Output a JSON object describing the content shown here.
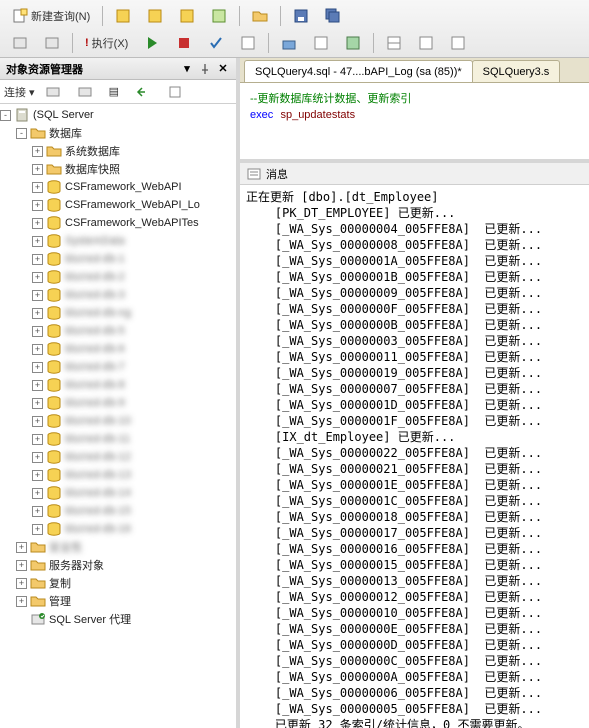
{
  "toolbar": {
    "newQuery": "新建查询(N)",
    "execute": "执行(X)"
  },
  "sidebar": {
    "title": "对象资源管理器",
    "connectLabel": "连接 ▾",
    "nodes": [
      {
        "depth": 0,
        "toggle": "-",
        "icon": "server",
        "label": "",
        "suffix": "(SQL Server",
        "blur": true
      },
      {
        "depth": 1,
        "toggle": "-",
        "icon": "folder",
        "label": "数据库"
      },
      {
        "depth": 2,
        "toggle": "+",
        "icon": "folder",
        "label": "系统数据库"
      },
      {
        "depth": 2,
        "toggle": "+",
        "icon": "folder",
        "label": "数据库快照"
      },
      {
        "depth": 2,
        "toggle": "+",
        "icon": "db",
        "label": "CSFramework_WebAPI"
      },
      {
        "depth": 2,
        "toggle": "+",
        "icon": "db",
        "label": "CSFramework_WebAPI_Lo"
      },
      {
        "depth": 2,
        "toggle": "+",
        "icon": "db",
        "label": "CSFramework_WebAPITes"
      },
      {
        "depth": 2,
        "toggle": "+",
        "icon": "db",
        "label": "SystemData",
        "blur": true
      },
      {
        "depth": 2,
        "toggle": "+",
        "icon": "db",
        "label": "blurred-db-1",
        "blur": true
      },
      {
        "depth": 2,
        "toggle": "+",
        "icon": "db",
        "label": "blurred-db-2",
        "blur": true
      },
      {
        "depth": 2,
        "toggle": "+",
        "icon": "db",
        "label": "blurred-db-3",
        "blur": true
      },
      {
        "depth": 2,
        "toggle": "+",
        "icon": "db",
        "label": "blurred-db-ng",
        "blur": true
      },
      {
        "depth": 2,
        "toggle": "+",
        "icon": "db",
        "label": "blurred-db-5",
        "blur": true
      },
      {
        "depth": 2,
        "toggle": "+",
        "icon": "db",
        "label": "blurred-db-6",
        "blur": true
      },
      {
        "depth": 2,
        "toggle": "+",
        "icon": "db",
        "label": "blurred-db-7",
        "blur": true
      },
      {
        "depth": 2,
        "toggle": "+",
        "icon": "db",
        "label": "blurred-db-8",
        "blur": true
      },
      {
        "depth": 2,
        "toggle": "+",
        "icon": "db",
        "label": "blurred-db-9",
        "blur": true
      },
      {
        "depth": 2,
        "toggle": "+",
        "icon": "db",
        "label": "blurred-db-10",
        "blur": true
      },
      {
        "depth": 2,
        "toggle": "+",
        "icon": "db",
        "label": "blurred-db-11",
        "blur": true
      },
      {
        "depth": 2,
        "toggle": "+",
        "icon": "db",
        "label": "blurred-db-12",
        "blur": true
      },
      {
        "depth": 2,
        "toggle": "+",
        "icon": "db",
        "label": "blurred-db-13",
        "blur": true
      },
      {
        "depth": 2,
        "toggle": "+",
        "icon": "db",
        "label": "blurred-db-14",
        "blur": true
      },
      {
        "depth": 2,
        "toggle": "+",
        "icon": "db",
        "label": "blurred-db-15",
        "blur": true
      },
      {
        "depth": 2,
        "toggle": "+",
        "icon": "db",
        "label": "blurred-db-16",
        "blur": true
      },
      {
        "depth": 1,
        "toggle": "+",
        "icon": "folder",
        "label": "安全性",
        "blur": true
      },
      {
        "depth": 1,
        "toggle": "+",
        "icon": "folder",
        "label": "服务器对象"
      },
      {
        "depth": 1,
        "toggle": "+",
        "icon": "folder",
        "label": "复制"
      },
      {
        "depth": 1,
        "toggle": "+",
        "icon": "folder",
        "label": "管理"
      },
      {
        "depth": 1,
        "toggle": "",
        "icon": "agent",
        "label": "SQL Server 代理"
      }
    ]
  },
  "tabs": {
    "active": "SQLQuery4.sql - 47....bAPI_Log (sa (85))*",
    "other": "SQLQuery3.s"
  },
  "code": {
    "comment": "--更新数据库统计数据、更新索引",
    "kw": "exec",
    "sp": "sp_updatestats"
  },
  "messages": {
    "header": "消息",
    "lines": [
      "正在更新 [dbo].[dt_Employee]",
      "    [PK_DT_EMPLOYEE] 已更新...",
      "    [_WA_Sys_00000004_005FFE8A]  已更新...",
      "    [_WA_Sys_00000008_005FFE8A]  已更新...",
      "    [_WA_Sys_0000001A_005FFE8A]  已更新...",
      "    [_WA_Sys_0000001B_005FFE8A]  已更新...",
      "    [_WA_Sys_00000009_005FFE8A]  已更新...",
      "    [_WA_Sys_0000000F_005FFE8A]  已更新...",
      "    [_WA_Sys_0000000B_005FFE8A]  已更新...",
      "    [_WA_Sys_00000003_005FFE8A]  已更新...",
      "    [_WA_Sys_00000011_005FFE8A]  已更新...",
      "    [_WA_Sys_00000019_005FFE8A]  已更新...",
      "    [_WA_Sys_00000007_005FFE8A]  已更新...",
      "    [_WA_Sys_0000001D_005FFE8A]  已更新...",
      "    [_WA_Sys_0000001F_005FFE8A]  已更新...",
      "    [IX_dt_Employee] 已更新...",
      "    [_WA_Sys_00000022_005FFE8A]  已更新...",
      "    [_WA_Sys_00000021_005FFE8A]  已更新...",
      "    [_WA_Sys_0000001E_005FFE8A]  已更新...",
      "    [_WA_Sys_0000001C_005FFE8A]  已更新...",
      "    [_WA_Sys_00000018_005FFE8A]  已更新...",
      "    [_WA_Sys_00000017_005FFE8A]  已更新...",
      "    [_WA_Sys_00000016_005FFE8A]  已更新...",
      "    [_WA_Sys_00000015_005FFE8A]  已更新...",
      "    [_WA_Sys_00000013_005FFE8A]  已更新...",
      "    [_WA_Sys_00000012_005FFE8A]  已更新...",
      "    [_WA_Sys_00000010_005FFE8A]  已更新...",
      "    [_WA_Sys_0000000E_005FFE8A]  已更新...",
      "    [_WA_Sys_0000000D_005FFE8A]  已更新...",
      "    [_WA_Sys_0000000C_005FFE8A]  已更新...",
      "    [_WA_Sys_0000000A_005FFE8A]  已更新...",
      "    [_WA_Sys_00000006_005FFE8A]  已更新...",
      "    [_WA_Sys_00000005_005FFE8A]  已更新...",
      "    已更新 32 条索引/统计信息，0 不需要更新。"
    ]
  }
}
